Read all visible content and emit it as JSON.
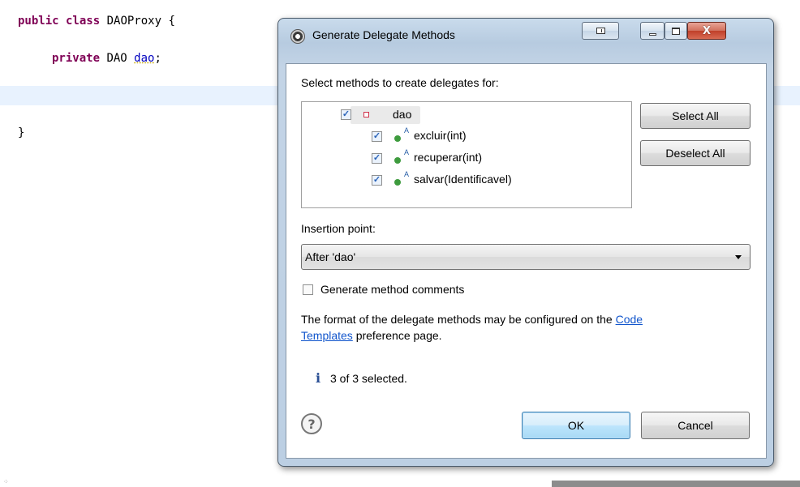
{
  "editor": {
    "line1_keyword": "public class",
    "line1_rest": " DAOProxy {",
    "line2_keyword": "private",
    "line2_type": " DAO ",
    "line2_field": "dao",
    "line2_end": ";",
    "line3": "}"
  },
  "dialog": {
    "title": "Generate Delegate Methods",
    "select_label": "Select methods to create delegates for:",
    "tree": {
      "root": {
        "label": "dao",
        "checked": true
      },
      "methods": [
        {
          "label": "excluir(int)",
          "checked": true
        },
        {
          "label": "recuperar(int)",
          "checked": true
        },
        {
          "label": "salvar(Identificavel)",
          "checked": true
        }
      ],
      "abstract_mark": "A"
    },
    "buttons": {
      "select_all": "Select All",
      "deselect_all": "Deselect All",
      "ok": "OK",
      "cancel": "Cancel"
    },
    "insertion_label": "Insertion point:",
    "insertion_value": "After 'dao'",
    "comments_label": "Generate method comments",
    "comments_checked": false,
    "info_prefix": "The format of the delegate methods may be configured on the ",
    "info_link": "Code Templates",
    "info_link_part1": "Code",
    "info_link_part2": "Templates",
    "info_suffix": " preference page.",
    "status_icon": "i",
    "status_text": "3 of 3 selected.",
    "help_glyph": "?",
    "close_glyph": "X"
  }
}
